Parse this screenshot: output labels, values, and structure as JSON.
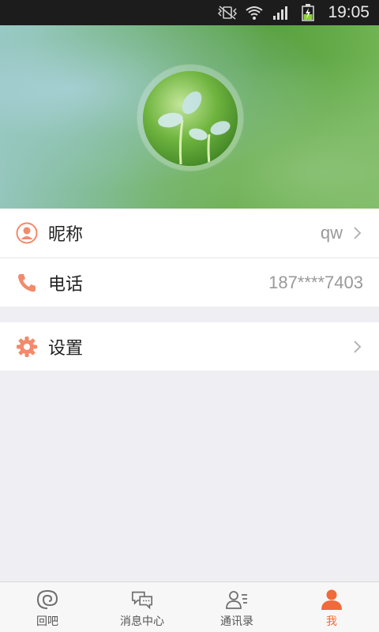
{
  "status_bar": {
    "time": "19:05",
    "icons": [
      "vibrate-icon",
      "wifi-icon",
      "signal-icon",
      "battery-charging-icon"
    ]
  },
  "header": {
    "avatar_icon": "seedling-avatar"
  },
  "profile": {
    "nickname": {
      "label": "昵称",
      "value": "qw",
      "icon": "user-icon"
    },
    "phone": {
      "label": "电话",
      "value": "187****7403",
      "icon": "phone-icon"
    }
  },
  "settings": {
    "label": "设置",
    "icon": "gear-icon"
  },
  "tabs": [
    {
      "label": "回吧",
      "icon": "swirl-icon"
    },
    {
      "label": "消息中心",
      "icon": "chat-bubbles-icon"
    },
    {
      "label": "通讯录",
      "icon": "contacts-icon"
    },
    {
      "label": "我",
      "icon": "person-icon",
      "active": true
    }
  ],
  "colors": {
    "accent": "#f06a3b",
    "icon_orange": "#f28a6c",
    "background": "#efeef3"
  }
}
